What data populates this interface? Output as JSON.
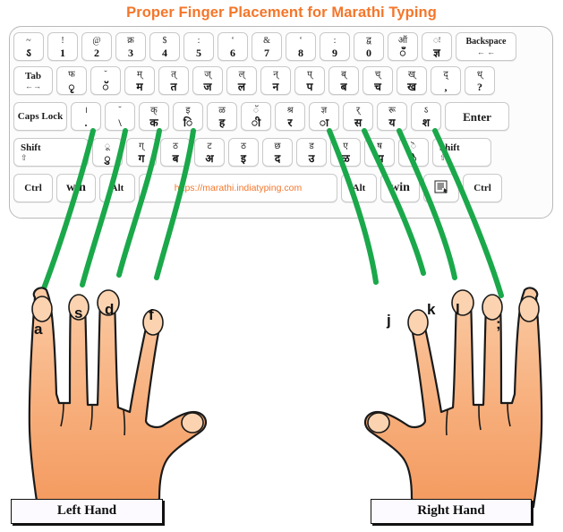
{
  "title": "Proper Finger Placement for Marathi Typing",
  "accent_color": "#F4762A",
  "guide_line_color": "#1aa84a",
  "skin_color": "#F6A96B",
  "keyboard": {
    "rows": [
      {
        "name": "number-row",
        "keys": [
          {
            "top": "~",
            "bot": "ऽ"
          },
          {
            "top": "!",
            "bot": "1"
          },
          {
            "top": "@",
            "bot": "2"
          },
          {
            "top": "क्र",
            "bot": "3"
          },
          {
            "top": "$",
            "bot": "4"
          },
          {
            "top": ":",
            "bot": "5"
          },
          {
            "top": "‘",
            "bot": "6"
          },
          {
            "top": "&",
            "bot": "7"
          },
          {
            "top": "‘",
            "bot": "8"
          },
          {
            "top": ":",
            "bot": "9"
          },
          {
            "top": "द्व",
            "bot": "0"
          },
          {
            "top": "ऑ",
            "bot": "ँ"
          },
          {
            "top": "ः",
            "bot": "ज्ञ"
          },
          {
            "label": "Backspace",
            "sub": "←    ←",
            "wide": "wide-back"
          }
        ]
      },
      {
        "name": "top-letter-row",
        "keys": [
          {
            "label": "Tab",
            "sub": "←→",
            "wide": "wide-tab"
          },
          {
            "top": "फ",
            "bot": "ृ"
          },
          {
            "top": "̆",
            "bot": "ॅ"
          },
          {
            "top": "म्",
            "bot": "म"
          },
          {
            "top": "त्",
            "bot": "त"
          },
          {
            "top": "ज्",
            "bot": "ज"
          },
          {
            "top": "ल्",
            "bot": "ल"
          },
          {
            "top": "न्",
            "bot": "न"
          },
          {
            "top": "प्",
            "bot": "प"
          },
          {
            "top": "ब्",
            "bot": "ब"
          },
          {
            "top": "च्",
            "bot": "च"
          },
          {
            "top": "ख्",
            "bot": "ख"
          },
          {
            "top": "द्",
            "bot": ","
          },
          {
            "top": "ध्",
            "bot": "?"
          }
        ]
      },
      {
        "name": "home-row",
        "keys": [
          {
            "label": "Caps Lock",
            "wide": "wide-caps"
          },
          {
            "top": "।",
            "bot": "."
          },
          {
            "top": "̆",
            "bot": "\\"
          },
          {
            "top": "क्",
            "bot": "क"
          },
          {
            "top": "इ",
            "bot": "ि"
          },
          {
            "top": "ळ",
            "bot": "ह"
          },
          {
            "top": "ॅ",
            "bot": "ी"
          },
          {
            "top": "श्र",
            "bot": "र"
          },
          {
            "top": "ज्ञ",
            "bot": "ा"
          },
          {
            "top": "र्",
            "bot": "स"
          },
          {
            "top": "रू",
            "bot": "य"
          },
          {
            "top": "ऽ",
            "bot": "श"
          },
          {
            "label": "Enter",
            "wide": "wide-enter"
          }
        ]
      },
      {
        "name": "shift-row",
        "keys": [
          {
            "label": "Shift",
            "sub": "⇧",
            "wide": "wide-shiftL"
          },
          {
            "top": "ू",
            "bot": "ु"
          },
          {
            "top": "ग्",
            "bot": "ग"
          },
          {
            "top": "ठ",
            "bot": "ब"
          },
          {
            "top": "ट",
            "bot": "अ"
          },
          {
            "top": "ठ",
            "bot": "इ"
          },
          {
            "top": "छ",
            "bot": "द"
          },
          {
            "top": "ड",
            "bot": "उ"
          },
          {
            "top": "ए",
            "bot": "ळ"
          },
          {
            "top": "ष",
            "bot": "झ"
          },
          {
            "top": "ॆ",
            "bot": "े"
          },
          {
            "label": "Shift",
            "sub": "⇧",
            "wide": "wide-shiftR"
          }
        ]
      },
      {
        "name": "bottom-row",
        "keys": [
          {
            "label": "Ctrl",
            "wide": "wide-ctrl"
          },
          {
            "label": "win",
            "wide": "wide-win"
          },
          {
            "label": "Alt",
            "wide": "wide-alt"
          },
          {
            "space": true,
            "url": "https://marathi.indiatyping.com"
          },
          {
            "label": "Alt",
            "wide": "wide-alt"
          },
          {
            "label": "win",
            "wide": "wide-win"
          },
          {
            "label": "menu",
            "icon": "menu-icon",
            "wide": "wide-menu"
          },
          {
            "label": "Ctrl",
            "wide": "wide-ctrl"
          }
        ]
      }
    ]
  },
  "hands": {
    "left": {
      "caption": "Left Hand",
      "fingers": [
        {
          "key": "a",
          "name": "pinky"
        },
        {
          "key": "s",
          "name": "ring"
        },
        {
          "key": "d",
          "name": "middle"
        },
        {
          "key": "f",
          "name": "index"
        }
      ]
    },
    "right": {
      "caption": "Right Hand",
      "fingers": [
        {
          "key": "j",
          "name": "index"
        },
        {
          "key": "k",
          "name": "middle"
        },
        {
          "key": "l",
          "name": "ring"
        },
        {
          "key": ";",
          "name": "pinky"
        }
      ]
    }
  }
}
